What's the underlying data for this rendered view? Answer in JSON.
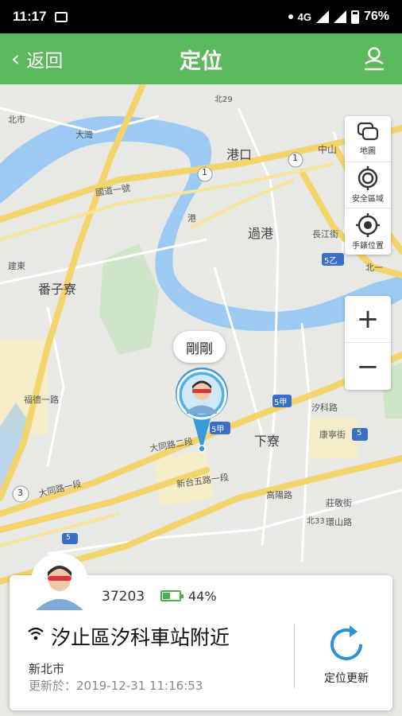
{
  "status_bar": {
    "time": "11:17",
    "network": "4G",
    "battery": "76%"
  },
  "header": {
    "back_label": "返回",
    "title": "定位",
    "bg_color": "#5cb85c"
  },
  "map": {
    "labels": {
      "gangkou": "港口",
      "guogang": "過港",
      "fanzicuo": "番子寮",
      "xialiao": "下寮",
      "road_zhongshan": "中山",
      "road_guodao": "國道一號",
      "road_changjiang": "長江街",
      "road_datong2": "大同路二段",
      "road_datong1": "大同路一段",
      "road_xintai": "新台五路一段",
      "road_xike": "汐科路",
      "road_kangning": "康寧街",
      "road_zhuangjing": "莊敬街",
      "road_huanshan": "環山路",
      "road_gaoyang": "高陽路",
      "road_beiyi": "北一",
      "road_jiandong": "建東",
      "road_beishi": "北市",
      "road_dajing": "大灣",
      "road_gangyu": "港",
      "road_fuxing": "福德一路",
      "shield_1a": "1",
      "shield_1b": "1",
      "shield_5yi": "5乙",
      "shield_5jia_a": "5甲",
      "shield_5jia_b": "5甲",
      "shield_5": "5",
      "shield_3": "3",
      "shield_5b": "5",
      "road_bei29": "北29",
      "road_bei33": "北33"
    }
  },
  "map_tools": [
    {
      "label": "地圖",
      "icon": "layers-icon"
    },
    {
      "label": "安全區域",
      "icon": "safe-zone-icon"
    },
    {
      "label": "手錶位置",
      "icon": "watch-location-icon"
    }
  ],
  "zoom": {
    "in": "+",
    "out": "−"
  },
  "bubble": {
    "text": "剛剛"
  },
  "card": {
    "device_id": "37203",
    "battery_pct": "44%",
    "battery_level": 0.44,
    "location": "汐止區汐科車站附近",
    "city": "新北市",
    "updated": "更新於：2019-12-31 11:16:53",
    "refresh_label": "定位更新"
  }
}
